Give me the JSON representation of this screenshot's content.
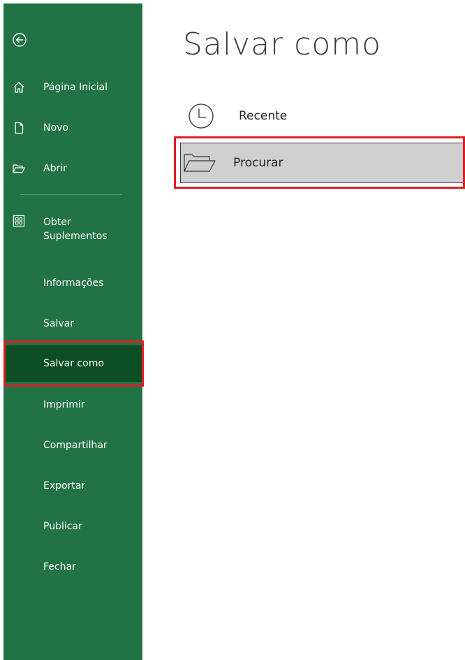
{
  "sidebar": {
    "items": [
      {
        "label": "Página Inicial",
        "icon": "home-icon"
      },
      {
        "label": "Novo",
        "icon": "new-document-icon"
      },
      {
        "label": "Abrir",
        "icon": "open-folder-icon"
      },
      {
        "label": "Obter Suplementos",
        "icon": "add-ins-icon"
      },
      {
        "label": "Informações"
      },
      {
        "label": "Salvar"
      },
      {
        "label": "Salvar como",
        "selected": true
      },
      {
        "label": "Imprimir"
      },
      {
        "label": "Compartilhar"
      },
      {
        "label": "Exportar"
      },
      {
        "label": "Publicar"
      },
      {
        "label": "Fechar"
      }
    ],
    "back_icon": "back-arrow-icon"
  },
  "main": {
    "title": "Salvar como",
    "locations": [
      {
        "label": "Recente",
        "icon": "clock-icon"
      },
      {
        "label": "Procurar",
        "icon": "folder-icon",
        "selected": true
      }
    ]
  },
  "colors": {
    "sidebar_bg": "#217346",
    "sidebar_selected": "#0e4e24",
    "highlight": "#e21b23",
    "browse_bg": "#cfcfcf"
  }
}
